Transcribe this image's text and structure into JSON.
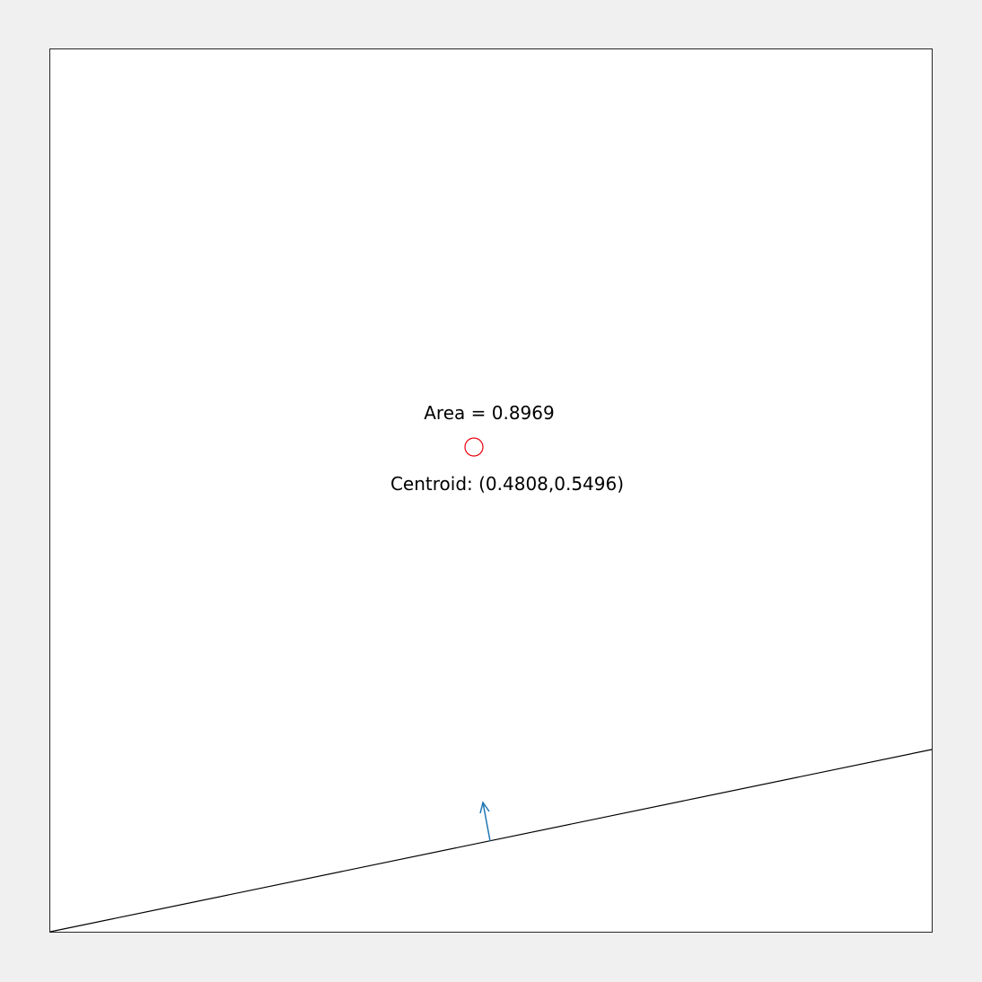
{
  "annotations": {
    "area_label": "Area = 0.8969",
    "centroid_label": "Centroid: (0.4808,0.5496)"
  },
  "values": {
    "area": 0.8969,
    "centroid": [
      0.4808,
      0.5496
    ]
  },
  "colors": {
    "background": "#f0f0f0",
    "plot_area": "#ffffff",
    "boundary_line": "#000000",
    "normal_arrow": "#1f77b4",
    "centroid_marker": "#e8000b"
  },
  "icons": {
    "centroid_marker": "circle-marker",
    "normal_vector": "arrow"
  }
}
